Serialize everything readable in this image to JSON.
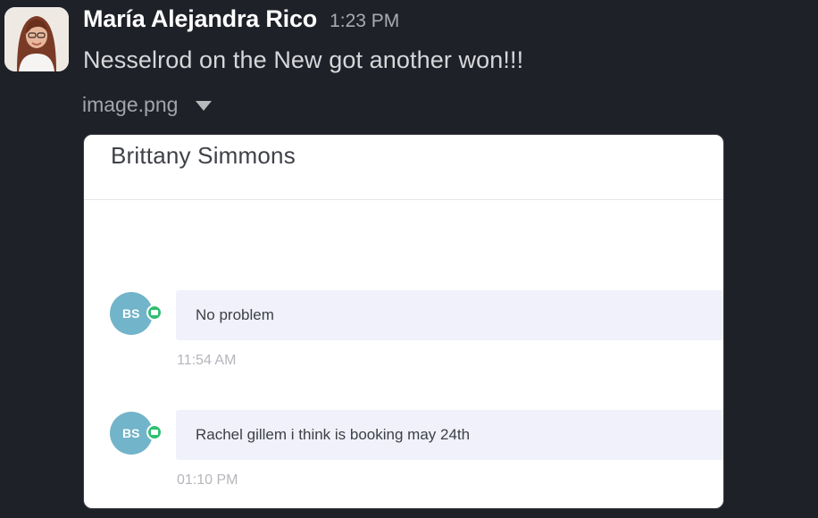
{
  "post": {
    "author": "María Alejandra Rico",
    "time": "1:23 PM",
    "message": "Nesselrod on the New got another won!!!",
    "file_name": "image.png"
  },
  "attachment": {
    "contact_name": "Brittany Simmons",
    "messages": [
      {
        "initials": "BS",
        "text": "No problem",
        "time": "11:54 AM"
      },
      {
        "initials": "BS",
        "text": "Rachel gillem i think is booking may 24th",
        "time": "01:10 PM"
      }
    ]
  }
}
